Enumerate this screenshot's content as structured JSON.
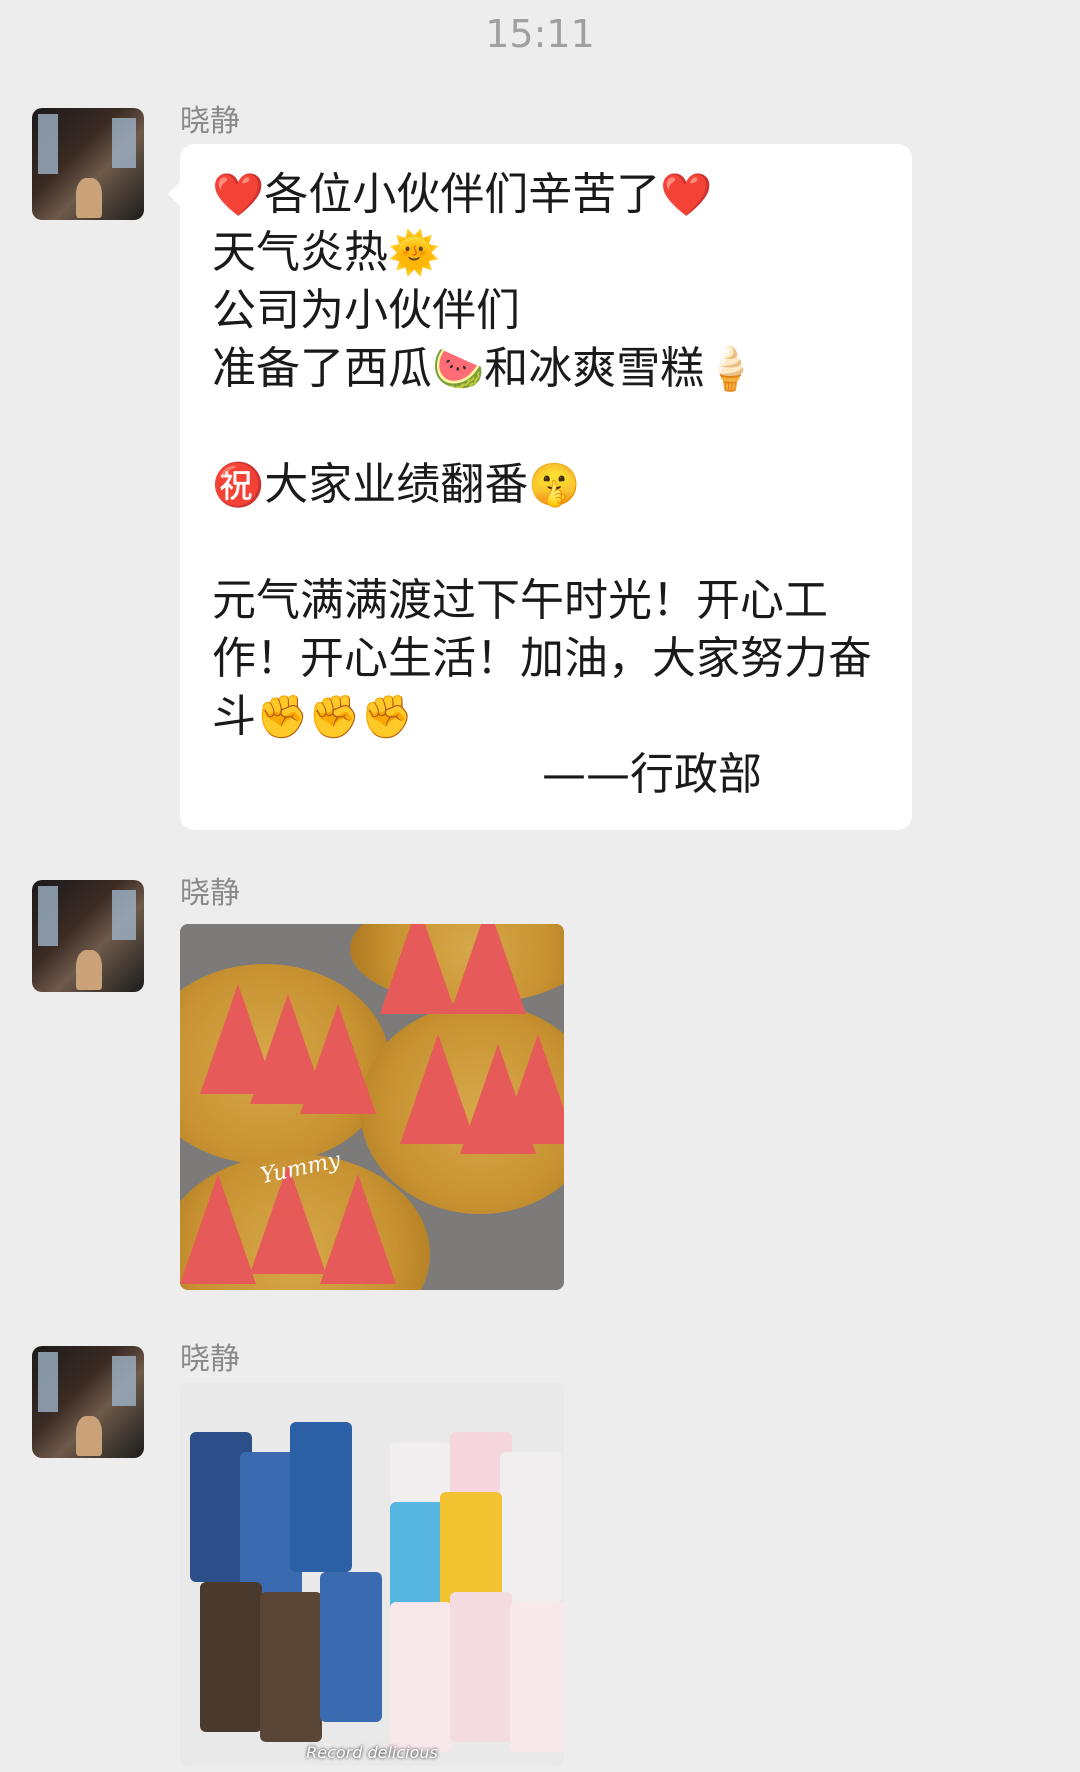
{
  "status": {
    "time": "15:11"
  },
  "messages": [
    {
      "sender": "晓静",
      "type": "text",
      "lines": [
        {
          "text": "各位小伙伴们辛苦了",
          "lead_emoji": "❤️",
          "trail_emoji": "❤️"
        },
        {
          "text": "天气炎热",
          "trail_emoji": "🌞"
        },
        {
          "text": "公司为小伙伴们"
        },
        {
          "text": "准备了西瓜",
          "mid_emoji": "🍉",
          "text2": "和冰爽雪糕",
          "trail_emoji": "🍦"
        },
        {
          "text": "大家业绩翻番",
          "lead_emoji": "㊗️",
          "trail_emoji": "🤫"
        },
        {
          "text": "元气满满渡过下午时光！开心工作！开心生活！加油，大家努力奋斗",
          "trail_emoji": "✊✊✊"
        },
        {
          "text": "——行政部"
        }
      ]
    },
    {
      "sender": "晓静",
      "type": "image",
      "image_desc": "watermelon-photo",
      "overlay_text": "Yummy"
    },
    {
      "sender": "晓静",
      "type": "image",
      "image_desc": "ice-cream-photo",
      "caption": "Record delicious"
    }
  ]
}
